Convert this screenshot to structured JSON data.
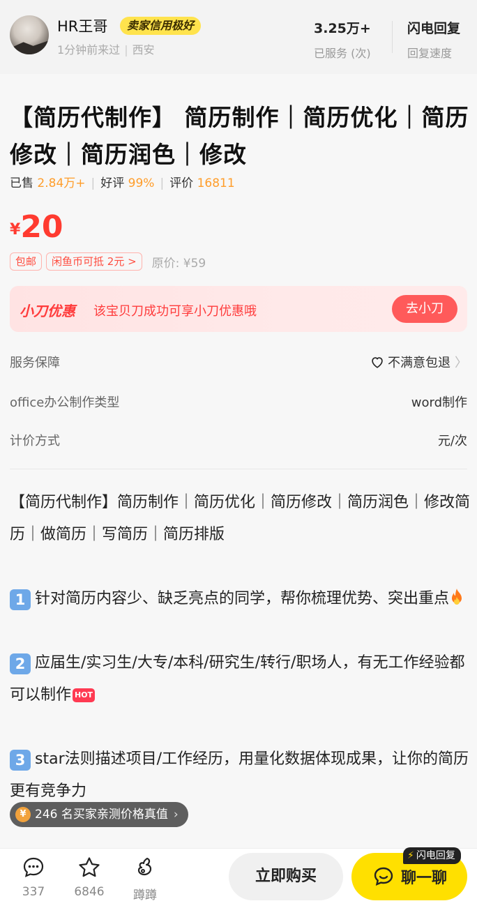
{
  "seller": {
    "name": "HR王哥",
    "badge": "卖家信用极好",
    "last_seen": "1分钟前来过",
    "location": "西安",
    "served_value": "3.25万+",
    "served_label": "已服务 (次)",
    "reply_value": "闪电回复",
    "reply_label": "回复速度"
  },
  "product": {
    "title": "【简历代制作】 简历制作｜简历优化｜简历修改｜简历润色｜修改",
    "sold_label": "已售",
    "sold_value": "2.84万+",
    "rating_label": "好评",
    "rating_value": "99%",
    "reviews_label": "评价",
    "reviews_value": "16811",
    "price_symbol": "¥",
    "price": "20",
    "tag_shipping": "包邮",
    "tag_coins": "闲鱼币可抵 2元",
    "original_price": "原价: ¥59"
  },
  "promo": {
    "name": "小刀优惠",
    "text": "该宝贝刀成功可享小刀优惠哦",
    "button": "去小刀"
  },
  "attributes": {
    "guarantee_label": "服务保障",
    "guarantee_value": "不满意包退",
    "type_label": "office办公制作类型",
    "type_value": "word制作",
    "pricing_label": "计价方式",
    "pricing_value": "元/次"
  },
  "description": {
    "intro": "【简历代制作】简历制作｜简历优化｜简历修改｜简历润色｜修改简历｜做简历｜写简历｜简历排版",
    "item1_num": "1",
    "item1": "针对简历内容少、缺乏亮点的同学，帮你梳理优势、突出重点",
    "item2_num": "2",
    "item2": "应届生/实习生/大专/本科/研究生/转行/职场人，有无工作经验都可以制作",
    "item3_num": "3",
    "item3": "star法则描述项目/工作经历，用量化数据体现成果，让你的简历更有竞争力",
    "hot_badge": "HOT"
  },
  "price_pill": {
    "text": "246 名买家亲测价格真值"
  },
  "bottom_bar": {
    "comments": "337",
    "favorites": "6846",
    "share_label": "蹲蹲",
    "buy_label": "立即购买",
    "chat_label": "聊一聊",
    "flash_badge": "闪电回复"
  },
  "colors": {
    "accent_red": "#ff3b30",
    "accent_orange": "#ff9d2a",
    "chat_yellow": "#ffe000",
    "badge_yellow": "#ffe34d"
  }
}
